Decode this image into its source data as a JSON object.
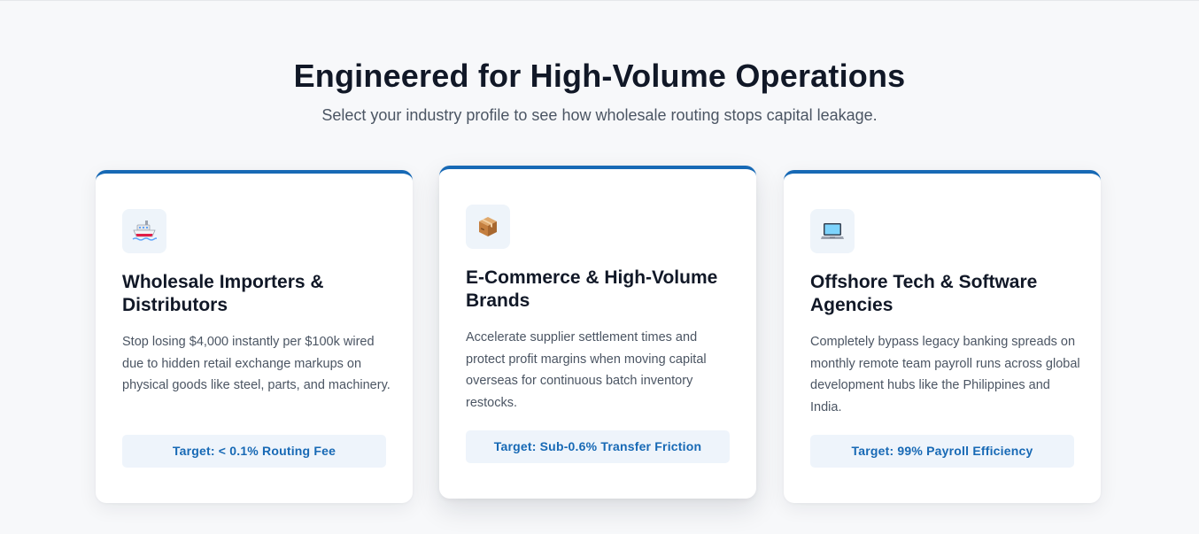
{
  "section": {
    "headline": "Engineered for High-Volume Operations",
    "subline": "Select your industry profile to see how wholesale routing stops capital leakage."
  },
  "cards": [
    {
      "icon": "cargo-ship-icon",
      "title": "Wholesale Importers & Distributors",
      "description": "Stop losing $4,000 instantly per $100k wired due to hidden retail exchange markups on physical goods like steel, parts, and machinery.",
      "target": "Target: < 0.1% Routing Fee"
    },
    {
      "icon": "package-box-icon",
      "title": "E-Commerce & High-Volume Brands",
      "description": "Accelerate supplier settlement times and protect profit margins when moving capital overseas for continuous batch inventory restocks.",
      "target": "Target: Sub-0.6% Transfer Friction"
    },
    {
      "icon": "laptop-icon",
      "title": "Offshore Tech & Software Agencies",
      "description": "Completely bypass legacy banking spreads on monthly remote team payroll runs across global development hubs like the Philippines and India.",
      "target": "Target: 99% Payroll Efficiency"
    }
  ],
  "colors": {
    "accent": "#1769b5",
    "heading": "#111827",
    "body_text": "#4b5563",
    "background": "#f7f8fa",
    "badge_background": "#eef4fb"
  }
}
